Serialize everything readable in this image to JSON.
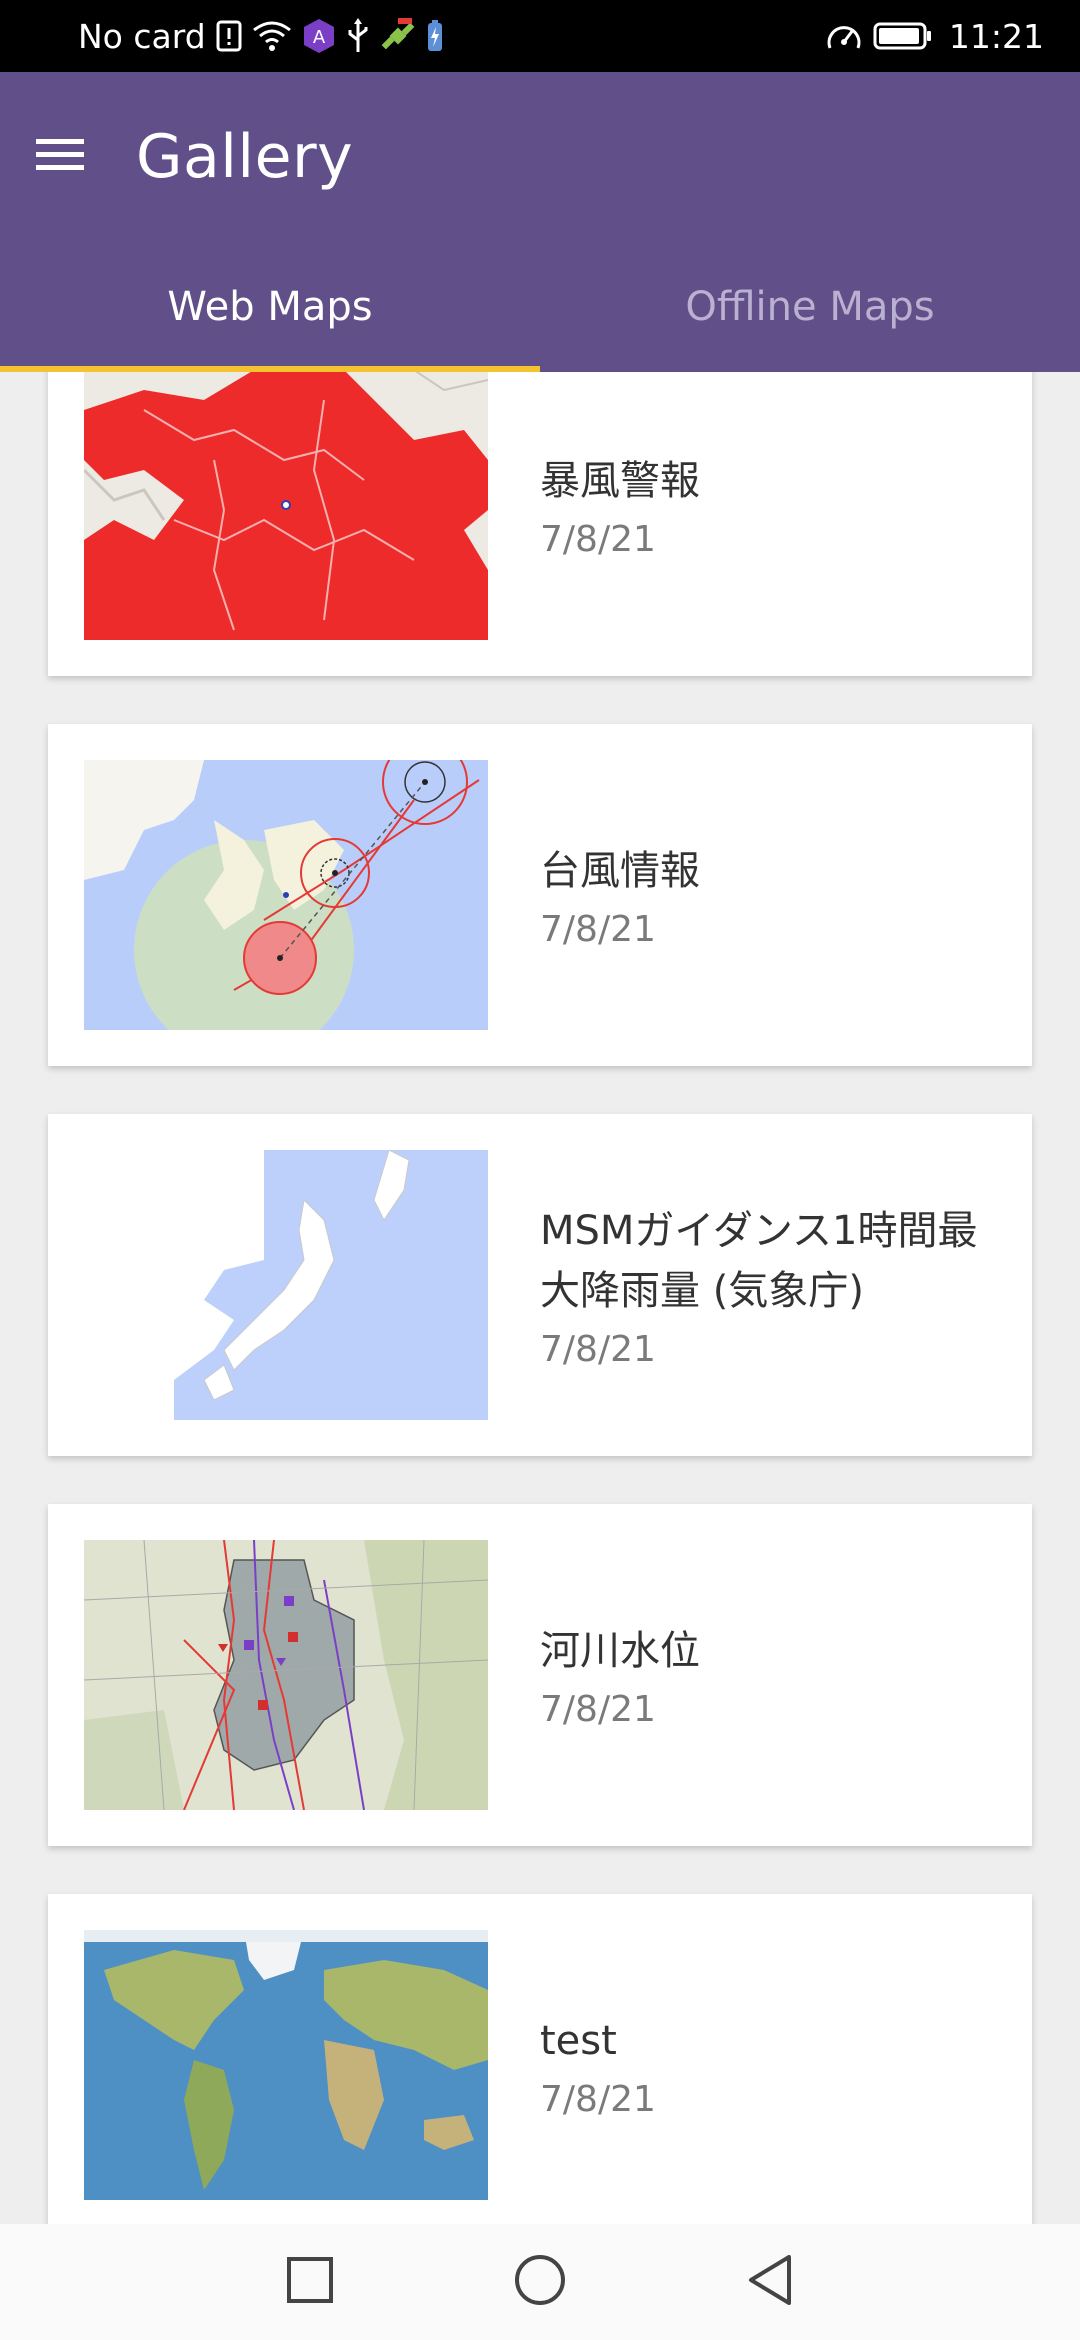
{
  "status_bar": {
    "carrier": "No card",
    "time": "11:21",
    "icons": [
      "sim-alert-icon",
      "wifi-icon",
      "app-notification-icon",
      "usb-icon",
      "satellite-icon",
      "battery-saver-icon",
      "speedometer-icon",
      "battery-icon"
    ]
  },
  "app_bar": {
    "title": "Gallery",
    "menu_icon": "hamburger-menu-icon",
    "background": "#614f8a"
  },
  "tabs": [
    {
      "label": "Web Maps",
      "active": true
    },
    {
      "label": "Offline Maps",
      "active": false
    }
  ],
  "tab_indicator_color": "#f4c430",
  "maps": [
    {
      "title": "暴風警報",
      "date": "7/8/21",
      "thumbnail": "warning-map-thumbnail"
    },
    {
      "title": "台風情報",
      "date": "7/8/21",
      "thumbnail": "typhoon-map-thumbnail"
    },
    {
      "title": "MSMガイダンス1時間最大降雨量 (気象庁)",
      "date": "7/8/21",
      "thumbnail": "rainfall-map-thumbnail"
    },
    {
      "title": "河川水位",
      "date": "7/8/21",
      "thumbnail": "river-level-map-thumbnail"
    },
    {
      "title": "test",
      "date": "7/8/21",
      "thumbnail": "world-map-thumbnail"
    }
  ],
  "nav_bar": {
    "icons": [
      "recents-square-icon",
      "home-circle-icon",
      "back-triangle-icon"
    ]
  }
}
